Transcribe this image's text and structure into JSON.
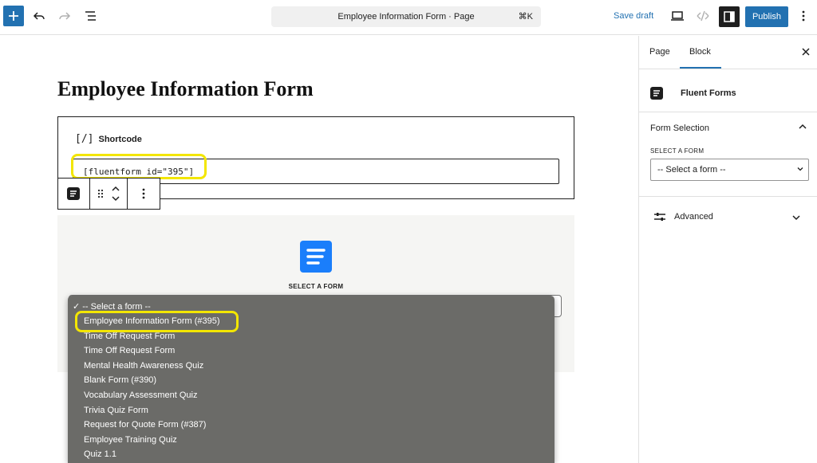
{
  "header": {
    "document_title": "Employee Information Form · Page",
    "shortcut": "⌘K",
    "save_draft": "Save draft",
    "publish": "Publish"
  },
  "canvas": {
    "page_title": "Employee Information Form",
    "shortcode": {
      "label_icon": "[/]",
      "label": "Shortcode",
      "value": "[fluentform id=\"395\"]"
    },
    "fluent_block": {
      "select_label": "SELECT A FORM"
    },
    "dropdown": {
      "selected": "✓ -- Select a form --",
      "options": [
        "Employee Information Form (#395)",
        "Time Off Request Form",
        "Time Off Request Form",
        "Mental Health Awareness Quiz",
        "Blank Form (#390)",
        "Vocabulary Assessment Quiz",
        "Trivia Quiz Form",
        "Request for Quote Form (#387)",
        "Employee Training Quiz",
        "Quiz 1.1"
      ]
    }
  },
  "sidebar": {
    "tabs": [
      "Page",
      "Block"
    ],
    "active_tab": "Block",
    "block_name": "Fluent Forms",
    "form_selection": {
      "title": "Form Selection",
      "select_label": "SELECT A FORM",
      "select_value": "-- Select a form --"
    },
    "advanced": "Advanced"
  },
  "colors": {
    "accent": "#2271b1",
    "highlight": "#f3e600",
    "fluent_blue": "#1a7efb"
  }
}
